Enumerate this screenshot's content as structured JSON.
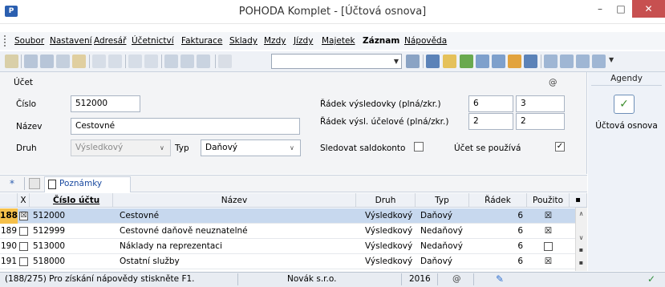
{
  "window": {
    "title": "POHODA Komplet - [Účtová osnova]",
    "app_icon_glyph": "P",
    "minimize_glyph": "–",
    "maximize_glyph": "□",
    "close_glyph": "✕"
  },
  "menu": [
    "Soubor",
    "Nastavení",
    "Adresář",
    "Účetnictví",
    "Fakturace",
    "Sklady",
    "Mzdy",
    "Jízdy",
    "Majetek",
    "Záznam",
    "Nápověda"
  ],
  "menu_bold_index": 9,
  "form": {
    "section_label": "Účet",
    "at_symbol": "@",
    "cislo_label": "Číslo",
    "cislo_value": "512000",
    "nazev_label": "Název",
    "nazev_value": "Cestovné",
    "druh_label": "Druh",
    "druh_value": "Výsledkový",
    "typ_label": "Typ",
    "typ_value": "Daňový",
    "radek_vysl_label": "Řádek výsledovky (plná/zkr.)",
    "radek_vysl_full": "6",
    "radek_vysl_short": "3",
    "radek_ucel_label": "Řádek výsl. účelové (plná/zkr.)",
    "radek_ucel_full": "2",
    "radek_ucel_short": "2",
    "saldo_label": "Sledovat saldokonto",
    "saldo_checked": false,
    "pouziva_label": "Účet se používá",
    "pouziva_checked": true,
    "check_glyph": "✓"
  },
  "agendy": {
    "title": "Agendy",
    "item_label": "Účtová osnova",
    "item_icon": "ledger-check-icon"
  },
  "tabs": {
    "star": "*",
    "notes_label": "Poznámky"
  },
  "table": {
    "headers": [
      "X",
      "Číslo účtu",
      "Název",
      "Druh",
      "Typ",
      "Řádek",
      "Použito"
    ],
    "rows": [
      {
        "num": "188",
        "x": true,
        "cislo": "512000",
        "nazev": "Cestovné",
        "druh": "Výsledkový",
        "typ": "Daňový",
        "radek": "6",
        "pouzito": true,
        "selected": true
      },
      {
        "num": "189",
        "x": false,
        "cislo": "512999",
        "nazev": "Cestovné daňově neuznatelné",
        "druh": "Výsledkový",
        "typ": "Nedaňový",
        "radek": "6",
        "pouzito": true,
        "selected": false
      },
      {
        "num": "190",
        "x": false,
        "cislo": "513000",
        "nazev": "Náklady na reprezentaci",
        "druh": "Výsledkový",
        "typ": "Nedaňový",
        "radek": "6",
        "pouzito": false,
        "selected": false
      },
      {
        "num": "191",
        "x": false,
        "cislo": "518000",
        "nazev": "Ostatní služby",
        "druh": "Výsledkový",
        "typ": "Daňový",
        "radek": "6",
        "pouzito": true,
        "selected": false
      }
    ],
    "checked_glyph": "☒"
  },
  "status": {
    "hint": "(188/275) Pro získání nápovědy stiskněte F1.",
    "company": "Novák s.r.o.",
    "year": "2016",
    "at": "@"
  },
  "colors": {
    "accent": "#2b5fb0",
    "selected_row": "#c7d8ee",
    "selected_rownum": "#f5c04a",
    "close_button": "#c75050"
  }
}
